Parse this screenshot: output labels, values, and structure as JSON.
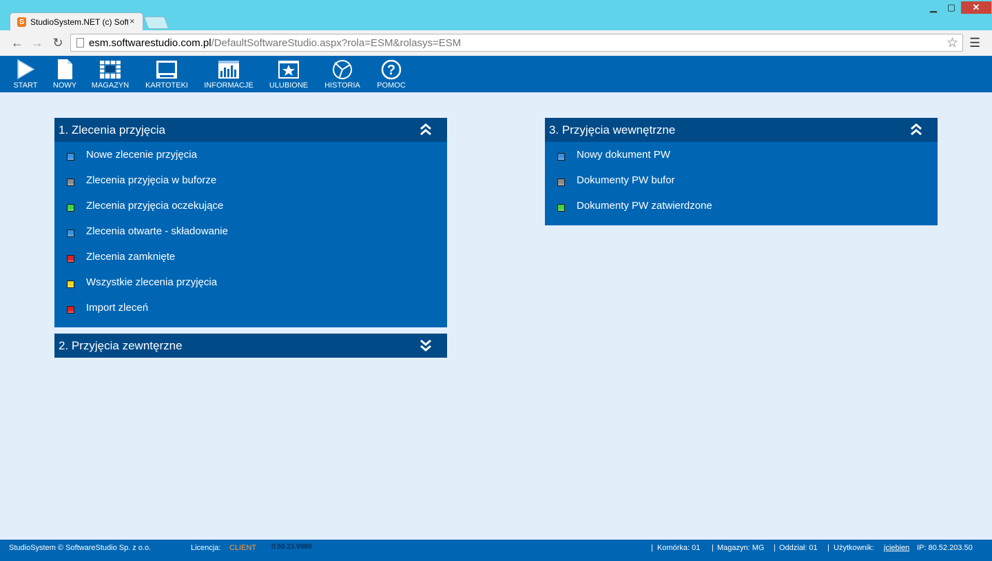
{
  "browser": {
    "tab_title": "StudioSystem.NET (c) Soft",
    "tab_favicon": "S",
    "tab_close": "×",
    "url_host": "esm.softwarestudio.com.pl",
    "url_rest": "/DefaultSoftwareStudio.aspx?rola=ESM&rolasys=ESM",
    "win_min": "▁",
    "win_max": "▢",
    "win_close": "✕"
  },
  "appbar": {
    "items": [
      {
        "label": "START",
        "icon": "play-icon"
      },
      {
        "label": "NOWY",
        "icon": "new-document-icon"
      },
      {
        "label": "MAGAZYN",
        "icon": "warehouse-grid-icon"
      },
      {
        "label": "KARTOTEKI",
        "icon": "monitor-icon"
      },
      {
        "label": "INFORMACJE",
        "icon": "bar-chart-icon"
      },
      {
        "label": "ULUBIONE",
        "icon": "star-icon"
      },
      {
        "label": "HISTORIA",
        "icon": "history-icon"
      },
      {
        "label": "POMOC",
        "icon": "help-icon"
      }
    ]
  },
  "panels": {
    "p1": {
      "title": "1. Zlecenia przyjęcia",
      "items": [
        {
          "label": "Nowe zlecenie przyjęcia",
          "color": "#3a8fe0"
        },
        {
          "label": "Zlecenia przyjęcia w buforze",
          "color": "#8a8a8a"
        },
        {
          "label": "Zlecenia przyjęcia oczekujące",
          "color": "#3fd23a"
        },
        {
          "label": "Zlecenia otwarte - składowanie",
          "color": "#3a8fe0"
        },
        {
          "label": "Zlecenia zamknięte",
          "color": "#e02020"
        },
        {
          "label": "Wszystkie zlecenia przyjęcia",
          "color": "#f2d21a"
        },
        {
          "label": "Import zleceń",
          "color": "#e02020"
        }
      ]
    },
    "p2": {
      "title": "2. Przyjęcia zewntęrzne",
      "items": []
    },
    "p3": {
      "title": "3. Przyjęcia wewnętrzne",
      "items": [
        {
          "label": "Nowy dokument PW",
          "color": "#3a8fe0"
        },
        {
          "label": "Dokumenty PW bufor",
          "color": "#8a8a8a"
        },
        {
          "label": "Dokumenty PW zatwierdzone",
          "color": "#3fd23a"
        }
      ]
    }
  },
  "status": {
    "copyright": "StudioSystem © SoftwareStudio Sp. z o.o.",
    "license_label": "Licencja:",
    "license_value": "CLIENT",
    "timer": "0:59.23.9989",
    "cell": "Komórka: 01",
    "warehouse": "Magazyn: MG",
    "branch": "Oddział: 01",
    "user_label": "Użytkownik:",
    "user": "jciebien",
    "ip": "IP: 80.52.203.50"
  }
}
